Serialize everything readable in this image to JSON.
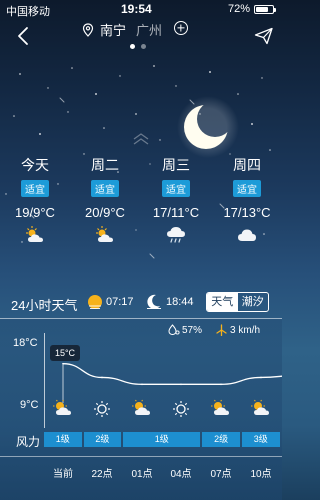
{
  "status": {
    "carrier": "中国移动",
    "time": "19:54",
    "battery": "72%",
    "battery_level": 0.72
  },
  "header": {
    "active_city": "南宁",
    "other_city": "广州",
    "page_count": 2,
    "active_page": 1
  },
  "forecast": [
    {
      "day": "今天",
      "tag": "适宜",
      "temp": "19/9°C",
      "icon": "partly-sunny-icon"
    },
    {
      "day": "周二",
      "tag": "适宜",
      "temp": "20/9°C",
      "icon": "partly-sunny-icon"
    },
    {
      "day": "周三",
      "tag": "适宜",
      "temp": "17/11°C",
      "icon": "rain-cloud-icon"
    },
    {
      "day": "周四",
      "tag": "适宜",
      "temp": "17/13°C",
      "icon": "cloud-icon"
    }
  ],
  "hourly_header": {
    "title": "24小时天气",
    "sunrise": "07:17",
    "sunset": "18:44",
    "toggle_weather": "天气",
    "toggle_tide": "潮汐"
  },
  "conditions": {
    "humidity": "57%",
    "wind_speed": "3 km/h"
  },
  "chart": {
    "axis_high": "18°C",
    "axis_low": "9°C",
    "tooltip": "15°C"
  },
  "chart_data": {
    "type": "line",
    "x": [
      "当前",
      "22点",
      "01点",
      "04点",
      "07点",
      "10点"
    ],
    "values": [
      15,
      13,
      12,
      12,
      12,
      13
    ],
    "ylim": [
      9,
      18
    ]
  },
  "wind": {
    "label": "风力",
    "segments": [
      {
        "label": "1级",
        "span": 1
      },
      {
        "label": "2级",
        "span": 1
      },
      {
        "label": "1级",
        "span": 2
      },
      {
        "label": "2级",
        "span": 1
      },
      {
        "label": "3级",
        "span": 1
      }
    ]
  },
  "hours": [
    "当前",
    "22点",
    "01点",
    "04点",
    "07点",
    "10点"
  ],
  "hour_icons": [
    "partly-sunny-icon",
    "sun-icon",
    "partly-sunny-icon",
    "sun-icon",
    "partly-sunny-icon",
    "partly-sunny-icon"
  ],
  "colors": {
    "accent": "#1d9bd8",
    "sun": "#f6b21b"
  }
}
